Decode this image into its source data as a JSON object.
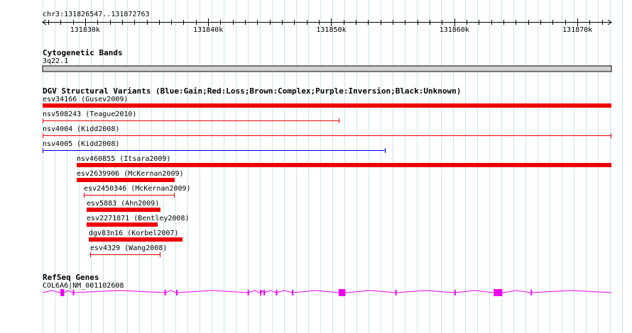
{
  "ruler": {
    "region": "chr3:131826547..131872763",
    "start": 131826547,
    "end": 131872763,
    "ticks": [
      {
        "pos": 131830000,
        "label": "131830k"
      },
      {
        "pos": 131840000,
        "label": "131840k"
      },
      {
        "pos": 131850000,
        "label": "131850k"
      },
      {
        "pos": 131860000,
        "label": "131860k"
      },
      {
        "pos": 131870000,
        "label": "131870k"
      }
    ]
  },
  "cytoband": {
    "title": "Cytogenetic Bands",
    "band": "3q22.1"
  },
  "dgv": {
    "title": "DGV Structural Variants (Blue:Gain;Red:Loss;Brown:Complex;Purple:Inversion;Black:Unknown)",
    "variants": [
      {
        "label": "esv34166 (Gusev2009)",
        "start": 131826547,
        "end": 131872763,
        "color": "#ee0000",
        "style": "thick"
      },
      {
        "label": "nsv508243 (Teague2010)",
        "start": 131826547,
        "end": 131850650,
        "color": "#ee0000",
        "style": "thin"
      },
      {
        "label": "nsv4004 (Kidd2008)",
        "start": 131826547,
        "end": 131872763,
        "color": "#ee0000",
        "style": "thin"
      },
      {
        "label": "nsv4005 (Kidd2008)",
        "start": 131826547,
        "end": 131854400,
        "color": "#0000dd",
        "style": "thin"
      },
      {
        "label": "nsv460855 (Itsara2009)",
        "start": 131829300,
        "end": 131872763,
        "color": "#ee0000",
        "style": "thick"
      },
      {
        "label": "esv2639906 (McKernan2009)",
        "start": 131829300,
        "end": 131837300,
        "color": "#ee0000",
        "style": "thick"
      },
      {
        "label": "esv2450346 (McKernan2009)",
        "start": 131829900,
        "end": 131837300,
        "color": "#ee0000",
        "style": "thin"
      },
      {
        "label": "esv5883 (Ahn2009)",
        "start": 131830100,
        "end": 131836100,
        "color": "#ee0000",
        "style": "thick"
      },
      {
        "label": "esv2271871 (Bentley2008)",
        "start": 131830100,
        "end": 131835900,
        "color": "#ee0000",
        "style": "thick"
      },
      {
        "label": "dgv83n16 (Korbel2007)",
        "start": 131830300,
        "end": 131837900,
        "color": "#ee0000",
        "style": "thick"
      },
      {
        "label": "esv4329 (Wang2008)",
        "start": 131830400,
        "end": 131836100,
        "color": "#ee0000",
        "style": "thin"
      }
    ]
  },
  "refseq": {
    "title": "RefSeq Genes",
    "gene_label": "COL6A6|NM_001102608",
    "color": "#ee00ee",
    "start": 131826547,
    "end": 131872763,
    "exons": [
      {
        "start": 131828000,
        "end": 131828300
      },
      {
        "start": 131829000,
        "end": 131829100
      },
      {
        "start": 131836450,
        "end": 131836550
      },
      {
        "start": 131837400,
        "end": 131837500
      },
      {
        "start": 131843200,
        "end": 131843300
      },
      {
        "start": 131844200,
        "end": 131844300
      },
      {
        "start": 131844500,
        "end": 131844600
      },
      {
        "start": 131845500,
        "end": 131845600
      },
      {
        "start": 131846800,
        "end": 131846900
      },
      {
        "start": 131850600,
        "end": 131851150
      },
      {
        "start": 131855200,
        "end": 131855300
      },
      {
        "start": 131860000,
        "end": 131860100
      },
      {
        "start": 131863200,
        "end": 131863900
      },
      {
        "start": 131866200,
        "end": 131866300
      }
    ]
  }
}
